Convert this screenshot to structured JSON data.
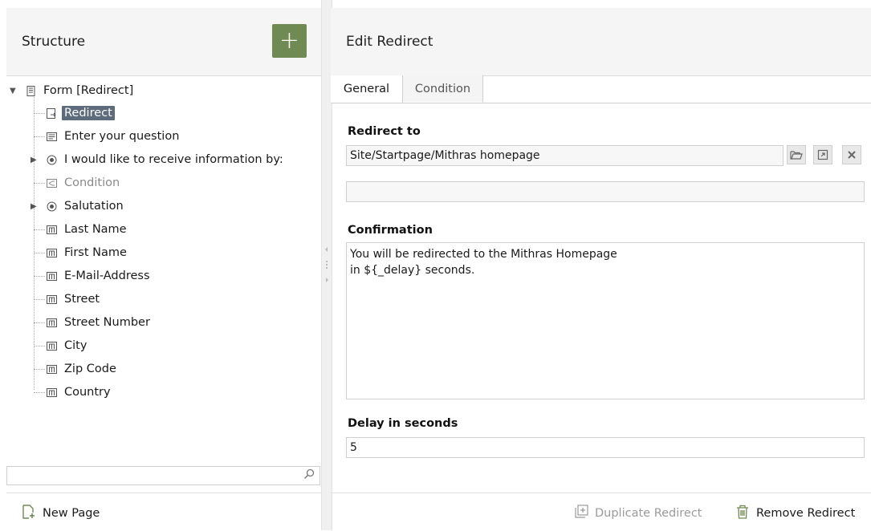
{
  "left": {
    "title": "Structure",
    "add_label": "+",
    "tree": {
      "root": "Form [Redirect]",
      "items": [
        {
          "label": "Redirect",
          "icon": "redirect-icon",
          "selected": true
        },
        {
          "label": "Enter your question",
          "icon": "textarea-icon"
        },
        {
          "label": "I would like to receive information by:",
          "icon": "radio-icon",
          "expandable": true
        },
        {
          "label": "Condition",
          "icon": "condition-icon",
          "dim": true
        },
        {
          "label": "Salutation",
          "icon": "radio-icon",
          "expandable": true
        },
        {
          "label": "Last Name",
          "icon": "textfield-icon"
        },
        {
          "label": "First Name",
          "icon": "textfield-icon"
        },
        {
          "label": "E-Mail-Address",
          "icon": "textfield-icon"
        },
        {
          "label": "Street",
          "icon": "textfield-icon"
        },
        {
          "label": "Street Number",
          "icon": "textfield-icon"
        },
        {
          "label": "City",
          "icon": "textfield-icon"
        },
        {
          "label": "Zip Code",
          "icon": "textfield-icon"
        },
        {
          "label": "Country",
          "icon": "textfield-icon"
        }
      ]
    },
    "search_placeholder": "",
    "new_page_label": "New Page"
  },
  "right": {
    "title": "Edit Redirect",
    "tabs": [
      {
        "label": "General",
        "active": true
      },
      {
        "label": "Condition",
        "active": false
      }
    ],
    "redirect_to_label": "Redirect to",
    "redirect_to_value": "Site/Startpage/Mithras homepage",
    "second_value": "",
    "confirmation_label": "Confirmation",
    "confirmation_value": "You will be redirected to the Mithras Homepage\nin ${_delay} seconds.",
    "delay_label": "Delay in seconds",
    "delay_value": "5",
    "duplicate_label": "Duplicate Redirect",
    "remove_label": "Remove Redirect"
  },
  "colors": {
    "accent": "#6f8a52",
    "selection": "#5d6b7d"
  }
}
